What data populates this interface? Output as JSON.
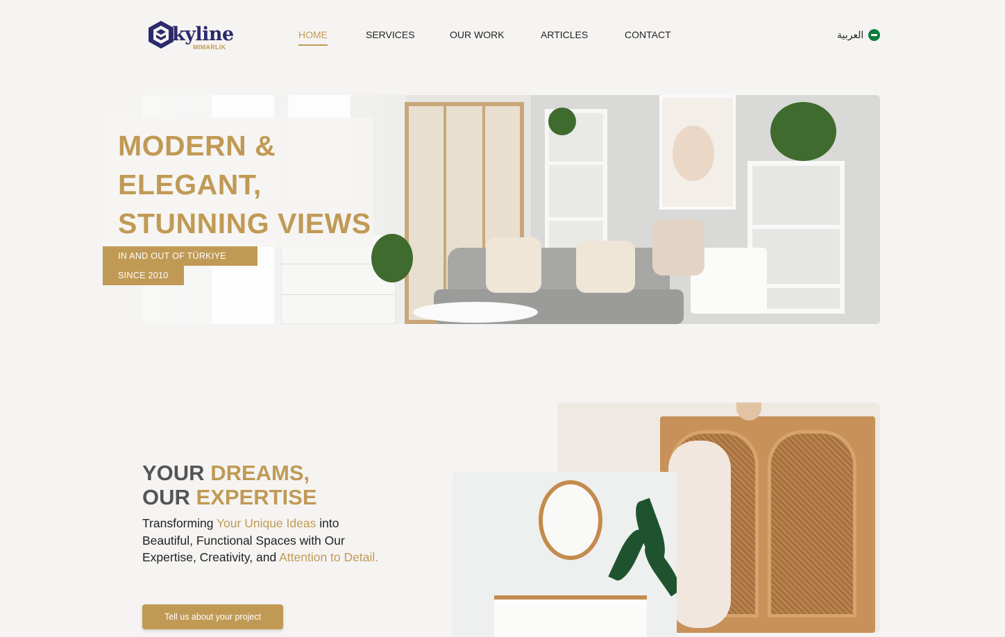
{
  "header": {
    "logo": {
      "word": "kyline",
      "sub": "MIMARLIK",
      "letter": "S"
    },
    "nav": [
      {
        "label": "HOME",
        "active": true
      },
      {
        "label": "SERVICES",
        "active": false
      },
      {
        "label": "OUR WORK",
        "active": false
      },
      {
        "label": "ARTICLES",
        "active": false
      },
      {
        "label": "CONTACT",
        "active": false
      }
    ],
    "language": {
      "label": "العربية",
      "icon": "saudi-flag-icon"
    }
  },
  "hero": {
    "title_lines": [
      "MODERN &",
      "ELEGANT,",
      "STUNNING VIEWS"
    ],
    "tag_1": "IN AND OUT OF TÜRKIYE",
    "tag_2": "SINCE 2010"
  },
  "dreams": {
    "heading_1a": "YOUR ",
    "heading_1b": "DREAMS,",
    "heading_2a": "OUR ",
    "heading_2b": "EXPERTISE",
    "para_1": "Transforming ",
    "para_2": "Your Unique Ideas",
    "para_3": " into Beautiful, Functional Spaces with Our Expertise, Creativity, and ",
    "para_4": "Attention to Detail.",
    "cta": "Tell us about your project"
  },
  "colors": {
    "accent": "#c09a55",
    "brand": "#2b2a6b",
    "background": "#f6f4f2"
  }
}
